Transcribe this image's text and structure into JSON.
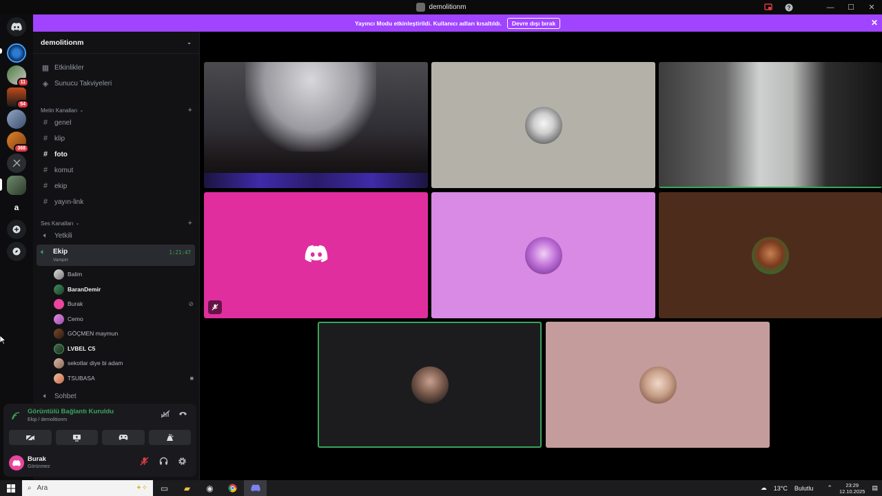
{
  "window": {
    "title": "demolitionm"
  },
  "banner": {
    "message": "Yayıncı Modu etkinleştirildi. Kullanıcı adları kısaltıldı.",
    "button": "Devre dışı bırak"
  },
  "server": {
    "name": "demolitionm"
  },
  "rail_badges": {
    "s2": "11",
    "s3": "54",
    "s5": "368"
  },
  "rail_letter": "a",
  "sidebar": {
    "top_links": [
      "Etkinlikler",
      "Sunucu Takviyeleri"
    ],
    "text_category": "Metin Kanalları",
    "text_channels": [
      "genel",
      "klip",
      "foto",
      "komut",
      "ekip",
      "yayın-link"
    ],
    "voice_category": "Ses Kanalları",
    "voice_channels": {
      "first": "Yetkili",
      "active": {
        "name": "Ekip",
        "sub": "Vampirr",
        "timer": "1:21:47"
      },
      "last": "Sohbet"
    },
    "members": [
      "Balim",
      "BaranDemir",
      "Burak",
      "Cemo",
      "GÖÇMEN maymun",
      "LVBEL C5",
      "sekotlar diye bi adam",
      "TSUBASA"
    ]
  },
  "connection": {
    "status": "Görüntülü Bağlantı Kuruldu",
    "location": "Ekip / demolitionm"
  },
  "user": {
    "name": "Burak",
    "status": "Görünmez"
  },
  "taskbar": {
    "search_placeholder": "Ara",
    "weather": "13°C",
    "weather_desc": "Bulutlu",
    "time": "23:29",
    "date": "12.10.2025"
  },
  "colors": {
    "accent": "#a044ff",
    "online_green": "#3ba55c",
    "tile_pink": "#e02e9e",
    "tile_lilac": "#d88ae4",
    "tile_grey": "#b4b2a8",
    "tile_brown": "#4e2c1c",
    "tile_dark": "#1c1c1e",
    "tile_rose": "#c49c9c"
  }
}
